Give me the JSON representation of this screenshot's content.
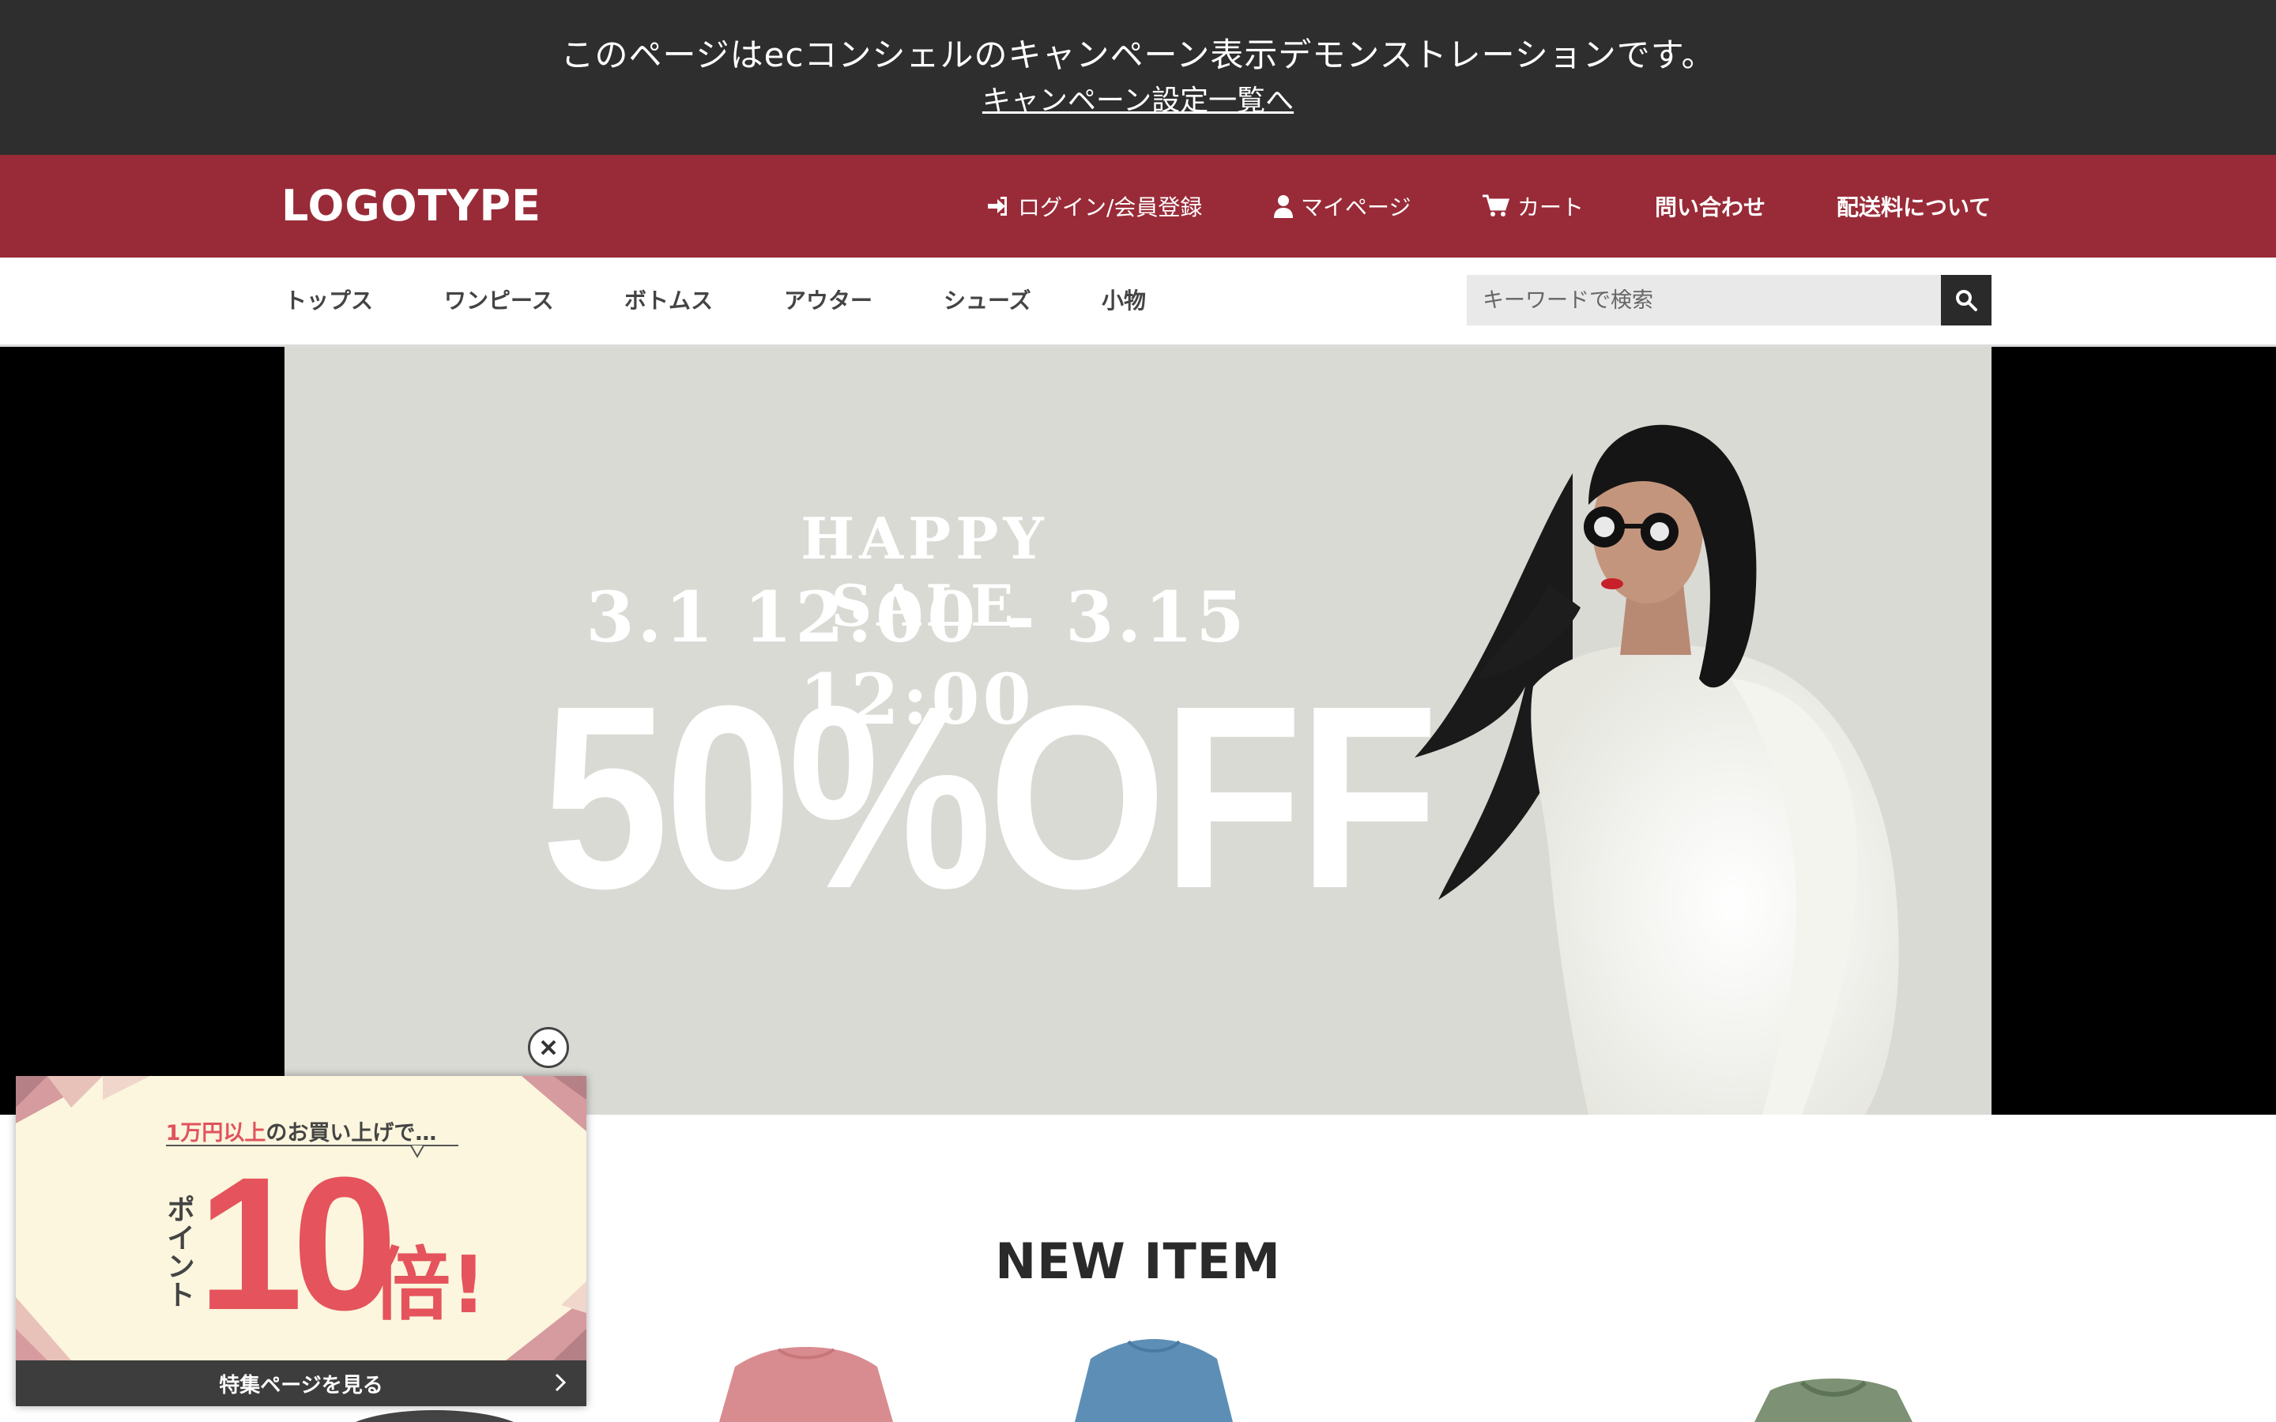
{
  "demo_banner": {
    "message": "このページはecコンシェルのキャンペーン表示デモンストレーションです。",
    "link": "キャンペーン設定一覧へ"
  },
  "header": {
    "logo": "LOGOTYPE",
    "nav": [
      {
        "label": "ログイン/会員登録",
        "icon": "login-icon"
      },
      {
        "label": "マイページ",
        "icon": "user-icon"
      },
      {
        "label": "カート",
        "icon": "cart-icon"
      },
      {
        "label": "問い合わせ"
      },
      {
        "label": "配送料について"
      }
    ]
  },
  "categories": [
    "トップス",
    "ワンピース",
    "ボトムス",
    "アウター",
    "シューズ",
    "小物"
  ],
  "search": {
    "placeholder": "キーワードで検索",
    "icon": "search-icon"
  },
  "hero": {
    "title": "HAPPY SALE",
    "dates": "3.1 12:00 - 3.15 12:00",
    "discount": "50%OFF"
  },
  "new_item": {
    "title": "NEW ITEM"
  },
  "popup": {
    "top_highlight": "1万円以上",
    "top_rest": "のお買い上げで…",
    "point_label": "ポイント",
    "multiplier": "10",
    "multiplier_suffix": "倍!",
    "cta": "特集ページを見る"
  },
  "colors": {
    "demo_bar": "#2e2e2e",
    "header": "#992b38",
    "accent": "#e5535c"
  }
}
